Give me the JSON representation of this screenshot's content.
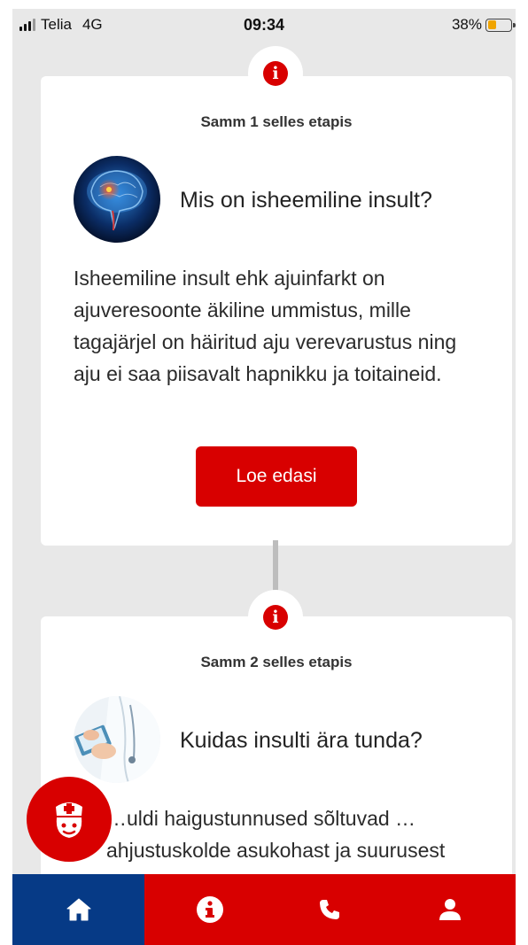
{
  "status_bar": {
    "carrier": "Telia",
    "network": "4G",
    "time": "09:34",
    "battery": "38%",
    "battery_level": 0.38,
    "battery_color": "#f0a400"
  },
  "colors": {
    "accent": "#d80000",
    "nav_active": "#063a86",
    "background": "#e8e8e8"
  },
  "steps": [
    {
      "icon": "info-icon",
      "label": "Samm 1 selles etapis",
      "title": "Mis on isheemiline insult?",
      "image": "brain-image",
      "body": "Isheemiline insult ehk ajuinfarkt on ajuveresoonte äkiline ummistus, mille tagajärjel on häiritud aju verevarustus ning aju ei saa piisavalt hapnikku ja toitaineid.",
      "button": "Loe edasi"
    },
    {
      "icon": "info-icon",
      "label": "Samm 2 selles etapis",
      "title": "Kuidas insulti ära tunda?",
      "image": "doctor-image",
      "body": "…uldi haigustunnused sõltuvad …ahjustuskolde asukohast ja suurusest"
    }
  ],
  "fab": {
    "icon": "nurse-icon"
  },
  "bottom_nav": [
    {
      "icon": "home-icon",
      "active": true
    },
    {
      "icon": "info-icon",
      "active": false
    },
    {
      "icon": "phone-icon",
      "active": false
    },
    {
      "icon": "user-icon",
      "active": false
    }
  ]
}
